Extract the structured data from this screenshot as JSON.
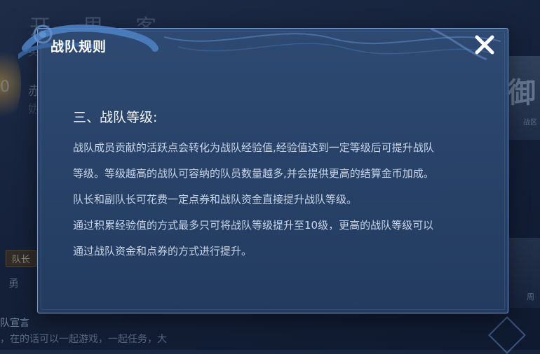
{
  "background": {
    "title": "开 里 客",
    "captain_badge": "队长",
    "declaration_title": "队宣言",
    "declaration_text": "，在的话可以一起游戏，一起任务，大"
  },
  "dialog": {
    "title": "战队规则",
    "close_icon": "close-icon",
    "section_heading": "三、战队等级:",
    "rules": [
      "战队成员贡献的活跃点会转化为战队经验值,经验值达到一定等级后可提升战队",
      "等级。等级越高的战队可容纳的队员数量越多,并会提供更高的结算金币加成。",
      "队长和副队长可花费一定点券和战队资金直接提升战队等级。",
      "通过积累经验值的方式最多只可将战队等级提升至10级，更高的战队等级可以",
      "通过战队资金和点券的方式进行提升。"
    ]
  },
  "colors": {
    "dialog_bg": "#29436a",
    "dialog_border": "#7a9cd0",
    "text_primary": "#ffffff",
    "text_body": "#c9d6ea"
  }
}
